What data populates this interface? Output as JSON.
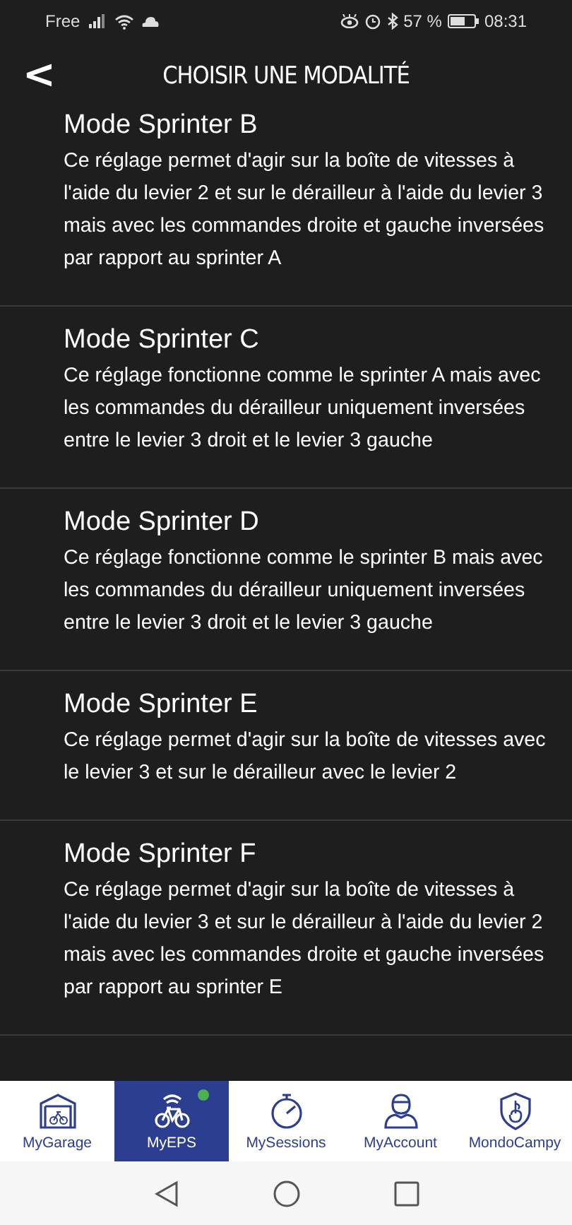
{
  "status_bar": {
    "carrier": "Free",
    "battery": "57 %",
    "time": "08:31"
  },
  "header": {
    "back": "<",
    "title": "CHOISIR UNE MODALITÉ"
  },
  "modes": [
    {
      "title": "Mode Sprinter B",
      "description": "Ce réglage permet d'agir sur la boîte de vitesses à l'aide du levier 2 et sur le dérailleur à l'aide du levier 3 mais avec les commandes droite et gauche inversées par rapport au sprinter A"
    },
    {
      "title": "Mode Sprinter C",
      "description": "Ce réglage fonctionne comme le sprinter A mais avec les commandes du dérailleur uniquement inversées entre le levier 3 droit et le levier 3 gauche"
    },
    {
      "title": "Mode Sprinter D",
      "description": "Ce réglage fonctionne comme le sprinter B mais avec les commandes du dérailleur uniquement inversées entre le levier 3 droit et le levier 3 gauche"
    },
    {
      "title": "Mode Sprinter E",
      "description": "Ce réglage permet d'agir sur la boîte de vitesses avec le levier 3 et sur le dérailleur avec le levier 2"
    },
    {
      "title": "Mode Sprinter F",
      "description": "Ce réglage permet d'agir sur la boîte de vitesses à l'aide du levier 3 et sur le dérailleur à l'aide du levier 2 mais avec les commandes droite et gauche inversées par rapport au sprinter E"
    }
  ],
  "tabs": [
    {
      "kind": "garage",
      "label": "MyGarage",
      "selected": false,
      "connected": false
    },
    {
      "kind": "bike",
      "label": "MyEPS",
      "selected": true,
      "connected": true
    },
    {
      "kind": "stopwatch",
      "label": "MySessions",
      "selected": false,
      "connected": false
    },
    {
      "kind": "account",
      "label": "MyAccount",
      "selected": false,
      "connected": false
    },
    {
      "kind": "shield",
      "label": "MondoCampy",
      "selected": false,
      "connected": false
    }
  ]
}
